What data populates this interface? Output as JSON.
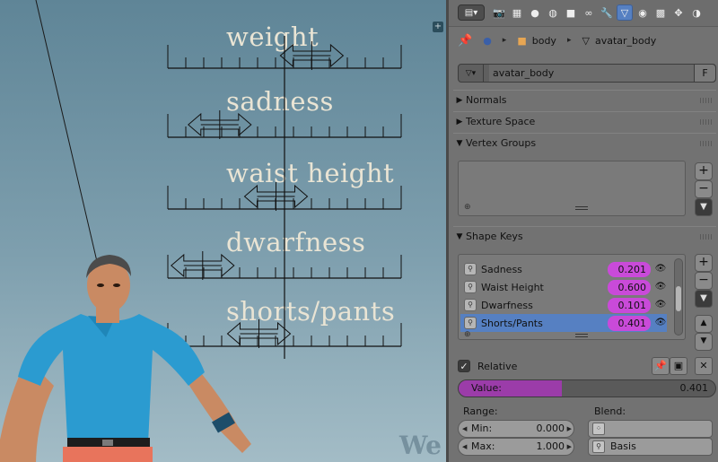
{
  "viewport": {
    "labels": [
      "weight",
      "sadness",
      "waist height",
      "dwarfness",
      "shorts/pants"
    ],
    "watermark": "We",
    "corner_button": "+",
    "slider_levels": [
      0.66,
      0.12,
      0.45,
      0.02,
      0.35
    ]
  },
  "panel": {
    "context_tabs": [
      "render-icon",
      "render-layers-icon",
      "scene-icon",
      "world-icon",
      "object-icon",
      "constraints-icon",
      "modifiers-icon",
      "data-icon",
      "material-icon",
      "texture-icon",
      "particles-icon",
      "physics-icon"
    ],
    "active_tab": "data-icon",
    "breadcrumb": {
      "object": "body",
      "mesh": "avatar_body"
    },
    "mesh_datablock": {
      "name": "avatar_body",
      "fake_user": "F"
    },
    "sections": {
      "normals": "Normals",
      "texture_space": "Texture Space",
      "vertex_groups": "Vertex Groups",
      "shape_keys": "Shape Keys"
    },
    "shape_keys": [
      {
        "name": "Sadness",
        "value": "0.201",
        "selected": false
      },
      {
        "name": "Waist Height",
        "value": "0.600",
        "selected": false
      },
      {
        "name": "Dwarfness",
        "value": "0.101",
        "selected": false
      },
      {
        "name": "Shorts/Pants",
        "value": "0.401",
        "selected": true
      }
    ],
    "relative_label": "Relative",
    "relative_checked": true,
    "value_slider": {
      "label": "Value:",
      "value": "0.401",
      "fraction": 0.401
    },
    "range_label": "Range:",
    "min_label": "Min:",
    "min_value": "0.000",
    "max_label": "Max:",
    "max_value": "1.000",
    "blend_label": "Blend:",
    "blend_basis": "Basis",
    "colors": {
      "accent_selected": "#5680c2",
      "value_fill": "#c94ad9",
      "panel_bg": "#727272"
    }
  }
}
